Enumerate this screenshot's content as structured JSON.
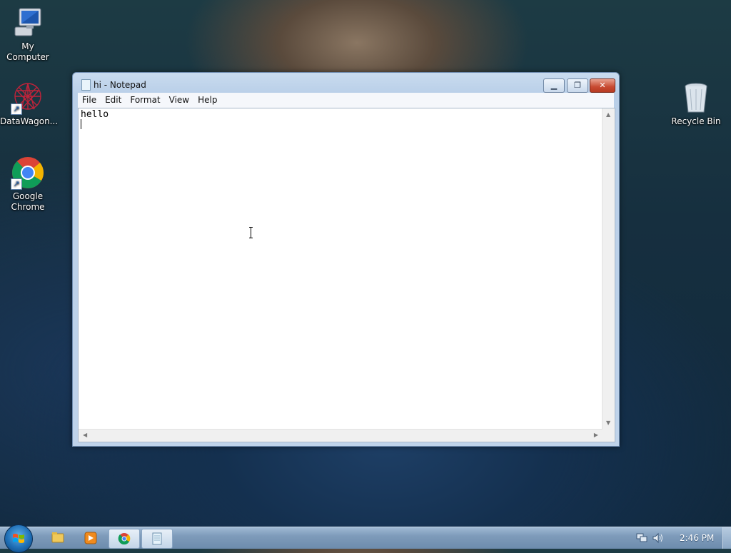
{
  "desktop": {
    "icons": [
      {
        "label": "My Computer",
        "icon": "computer-icon"
      },
      {
        "label": "DataWagon...",
        "icon": "datawagon-icon"
      },
      {
        "label": "Google Chrome",
        "icon": "chrome-icon"
      },
      {
        "label": "Recycle Bin",
        "icon": "recycle-bin-icon"
      }
    ]
  },
  "window": {
    "title": "hi - Notepad",
    "controls": {
      "minimize": "▁",
      "maximize": "❐",
      "close": "✕"
    },
    "menu": [
      "File",
      "Edit",
      "Format",
      "View",
      "Help"
    ],
    "content": "hello"
  },
  "taskbar": {
    "items": [
      "explorer-icon",
      "media-player-icon",
      "chrome-icon",
      "notepad-icon"
    ],
    "active": "notepad-icon",
    "clock": "2:46 PM"
  }
}
